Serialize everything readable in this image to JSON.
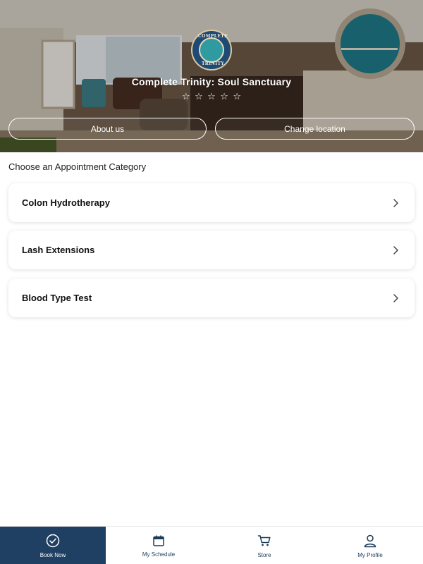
{
  "hero": {
    "business_name": "Complete Trinity: Soul Sanctuary",
    "logo_text_top": "COMPLETE",
    "logo_text_bottom": "TRINITY",
    "rating_icon": "star-outline-icon",
    "rating_value": 0,
    "rating_max": 5,
    "about_button": "About us",
    "change_location_button": "Change location"
  },
  "section": {
    "title": "Choose an Appointment Category"
  },
  "categories": [
    {
      "label": "Colon Hydrotherapy",
      "icon": "chevron-right-icon"
    },
    {
      "label": "Lash Extensions",
      "icon": "chevron-right-icon"
    },
    {
      "label": "Blood Type Test",
      "icon": "chevron-right-icon"
    }
  ],
  "bottom_nav": {
    "active_color": "#1f3f63",
    "items": [
      {
        "label": "Book Now",
        "icon": "check-circle-icon",
        "active": true
      },
      {
        "label": "My Schedule",
        "icon": "calendar-icon",
        "active": false
      },
      {
        "label": "Store",
        "icon": "cart-icon",
        "active": false
      },
      {
        "label": "My Profile",
        "icon": "user-icon",
        "active": false
      }
    ]
  }
}
